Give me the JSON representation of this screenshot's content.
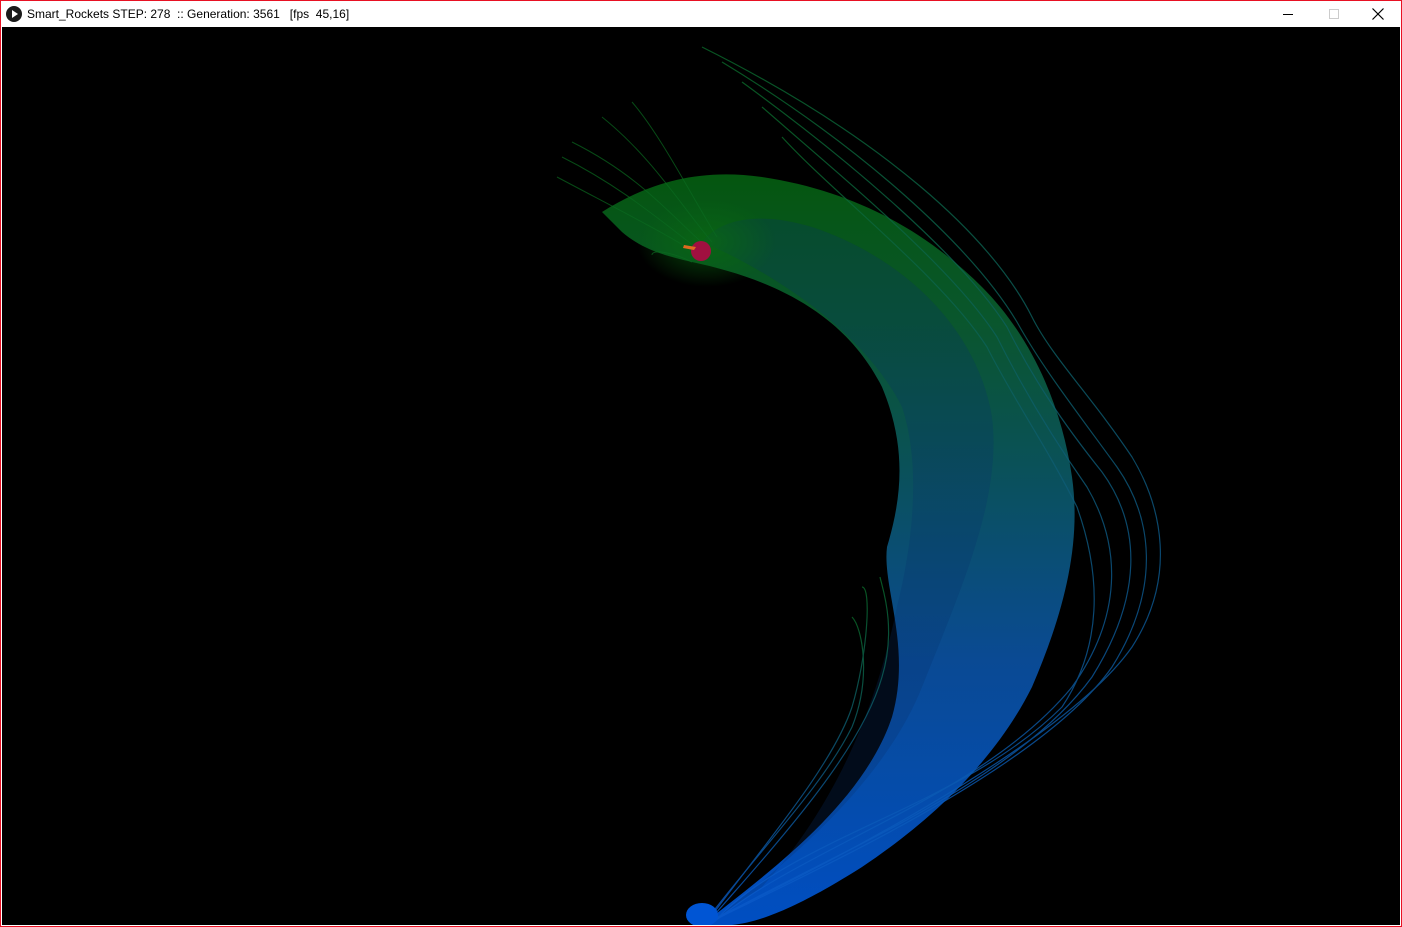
{
  "window": {
    "title": "Smart_Rockets STEP: 278  :: Generation: 3561   [fps  45,16]",
    "app_icon": "play-icon",
    "accent_border": "#e81123",
    "controls": {
      "minimize_icon": "minimize-icon",
      "maximize_icon": "maximize-icon",
      "close_icon": "close-icon"
    }
  },
  "simulation": {
    "background": "#000000",
    "trail_color_start": "#0050c8",
    "trail_color_end": "#006400",
    "target_color": "#a01040",
    "rocket_color": "#e06a20",
    "launch_color": "#0055d4"
  }
}
